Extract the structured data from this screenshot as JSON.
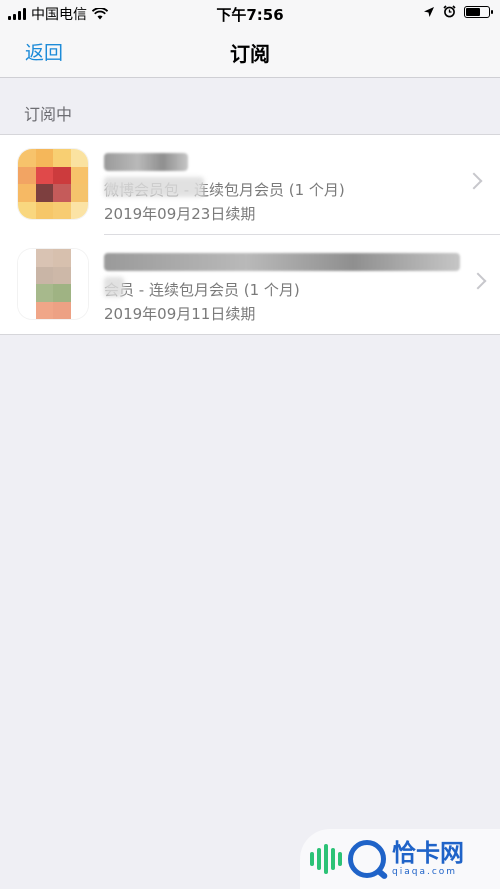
{
  "status_bar": {
    "carrier": "中国电信",
    "time": "下午7:56",
    "battery_level": 0.6
  },
  "nav": {
    "back_label": "返回",
    "title": "订阅"
  },
  "section": {
    "header": "订阅中"
  },
  "subscriptions": [
    {
      "plan": "微博会员包 - 连续包月会员 (1 个月)",
      "renewal": "2019年09月23日续期",
      "icon_colors": [
        "#f7c36b",
        "#f5b75a",
        "#f8cf72",
        "#fae2a0",
        "#f2a463",
        "#e0494a",
        "#cc3b3d",
        "#f7c26a",
        "#f6b964",
        "#7d3f3f",
        "#c55b5a",
        "#f5c36c",
        "#f9d77f",
        "#f6c769",
        "#f7cc72",
        "#fbe3a5"
      ]
    },
    {
      "plan": "会员 - 连续包月会员 (1 个月)",
      "renewal": "2019年09月11日续期",
      "icon_colors": [
        "#ffffff",
        "#d9c3b3",
        "#d7c0ae",
        "#ffffff",
        "#ffffff",
        "#c9b5a6",
        "#cdb8a8",
        "#ffffff",
        "#ffffff",
        "#a7b98c",
        "#9fb383",
        "#ffffff",
        "#ffffff",
        "#f0a688",
        "#eda184",
        "#ffffff"
      ]
    }
  ],
  "watermark": {
    "cn": "恰卡网",
    "en": "qiaqa.com"
  }
}
